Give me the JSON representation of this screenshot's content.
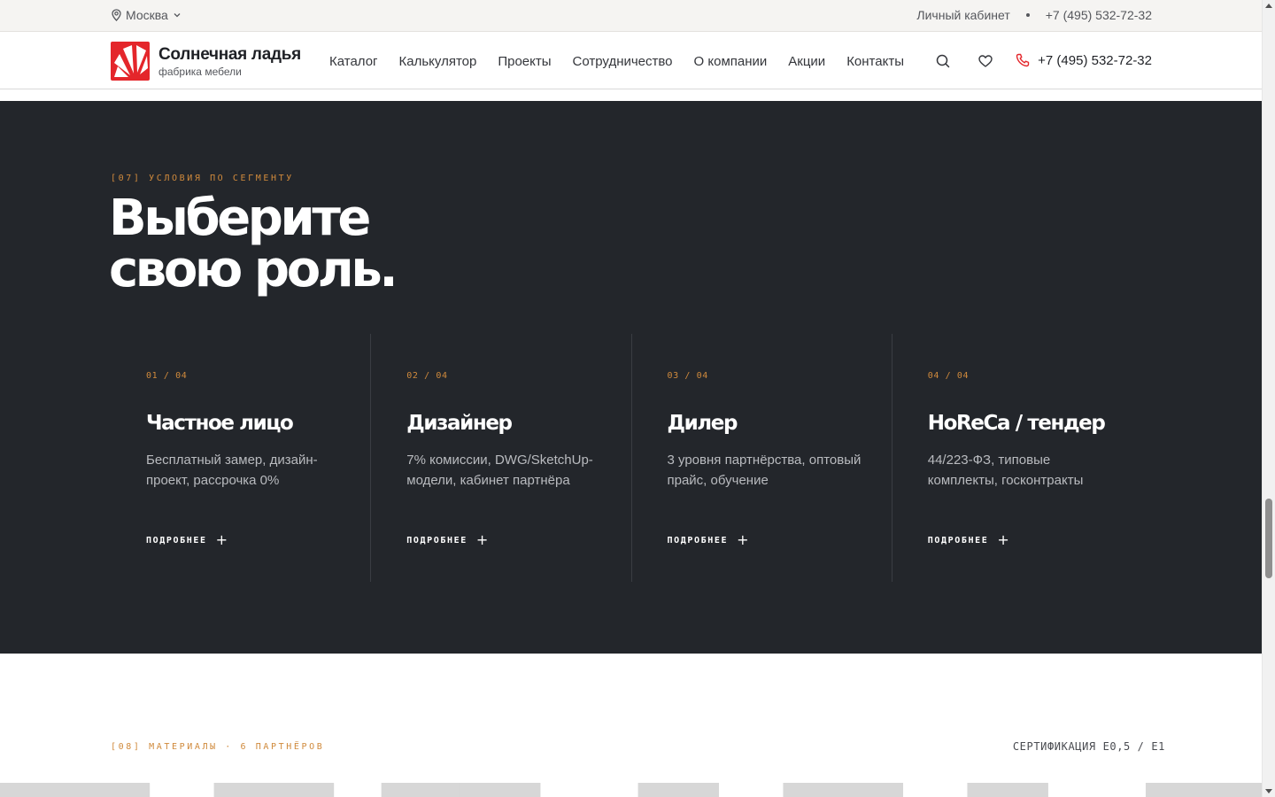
{
  "topbar": {
    "city": "Москва",
    "account_label": "Личный кабинет",
    "phone": "+7 (495) 532-72-32"
  },
  "header": {
    "logo_name": "Солнечная ладья",
    "logo_sub": "фабрика мебели",
    "nav": [
      "Каталог",
      "Калькулятор",
      "Проекты",
      "Сотрудничество",
      "О компании",
      "Акции",
      "Контакты"
    ],
    "phone": "+7 (495) 532-72-32"
  },
  "segment": {
    "eyebrow": "[07] УСЛОВИЯ ПО СЕГМЕНТУ",
    "title_line1": "Выберите",
    "title_line2": "свою роль.",
    "cards": [
      {
        "num": "01 / 04",
        "title": "Частное лицо",
        "desc": "Бесплатный замер, дизайн-проект, рассрочка 0%",
        "more": "ПОДРОБНЕЕ"
      },
      {
        "num": "02 / 04",
        "title": "Дизайнер",
        "desc": "7% комиссии, DWG/SketchUp-модели, кабинет партнёра",
        "more": "ПОДРОБНЕЕ"
      },
      {
        "num": "03 / 04",
        "title": "Дилер",
        "desc": "3 уровня партнёрства, оптовый прайс, обучение",
        "more": "ПОДРОБНЕЕ"
      },
      {
        "num": "04 / 04",
        "title": "HoReCa / тендер",
        "desc": "44/223-ФЗ, типовые комплекты, госконтракты",
        "more": "ПОДРОБНЕЕ"
      }
    ]
  },
  "materials": {
    "eyebrow": "[08] МАТЕРИАЛЫ · 6 ПАРТНЁРОВ",
    "certification": "СЕРТИФИКАЦИЯ E0,5 / E1"
  },
  "colors": {
    "accent": "#d08a3c",
    "brand_red": "#e4262b",
    "dark_bg": "#23262b"
  }
}
